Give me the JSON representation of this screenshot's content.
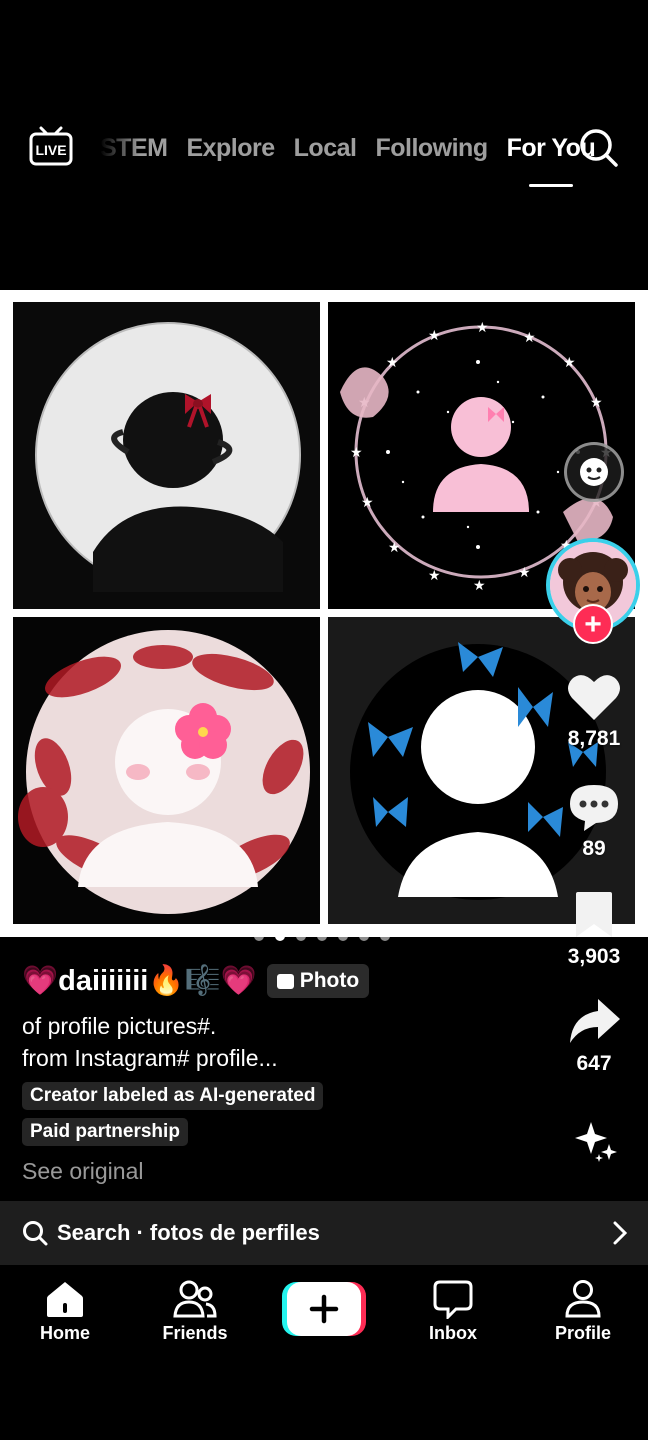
{
  "top_nav": {
    "live_label": "LIVE",
    "tabs": [
      "STEM",
      "Explore",
      "Local",
      "Following",
      "For You"
    ],
    "active_tab": "For You"
  },
  "post": {
    "author": "💗daiiiiiii🔥🎼💗",
    "type_chip": "Photo",
    "description_line1": "of profile pictures#.",
    "description_line2": "from Instagram# profile...",
    "label_ai": "Creator labeled as AI-generated",
    "label_paid": "Paid partnership",
    "see_original": "See original",
    "slide_count": 7,
    "active_slide": 2
  },
  "rail": {
    "likes": "8,781",
    "comments": "89",
    "saves": "3,903",
    "shares": "647"
  },
  "search_bar": {
    "text": "Search · fotos de perfiles"
  },
  "bottom_nav": {
    "items": [
      "Home",
      "Friends",
      "Inbox",
      "Profile"
    ]
  },
  "colors": {
    "accent_pink": "#fe2c55",
    "accent_cyan": "#25f4ee",
    "avatar_ring": "#3ad0ea"
  }
}
